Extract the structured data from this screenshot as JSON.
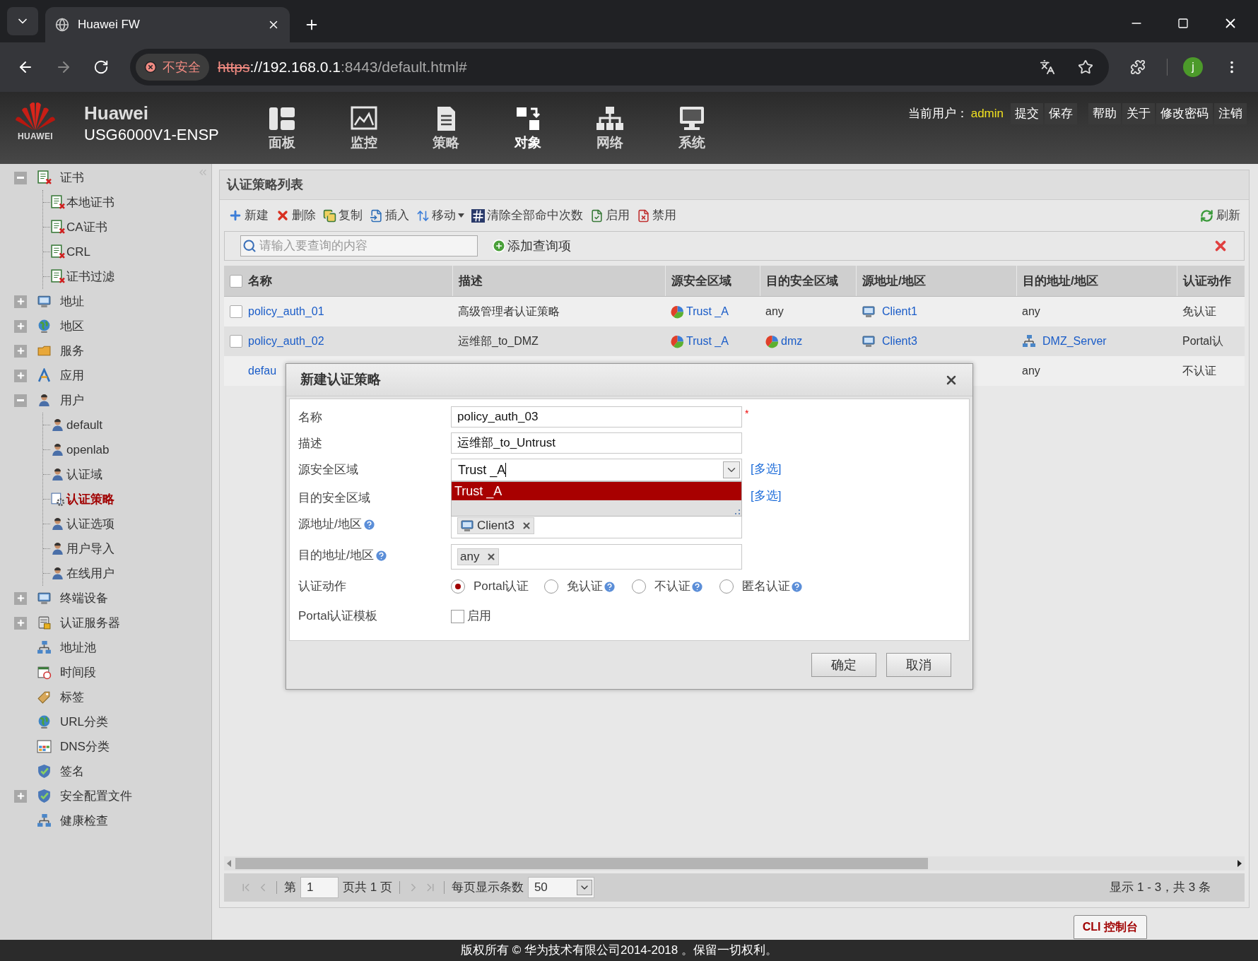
{
  "browser": {
    "tab_title": "Huawei FW",
    "security_label": "不安全",
    "url_scheme": "https",
    "url_host": "://192.168.0.1",
    "url_path": ":8443/default.html#",
    "profile_initial": "j"
  },
  "header": {
    "logo_text": "HUAWEI",
    "brand": "Huawei",
    "model": "USG6000V1-ENSP",
    "nav": [
      {
        "label": "面板",
        "selected": false
      },
      {
        "label": "监控",
        "selected": false
      },
      {
        "label": "策略",
        "selected": false
      },
      {
        "label": "对象",
        "selected": true
      },
      {
        "label": "网络",
        "selected": false
      },
      {
        "label": "系统",
        "selected": false
      }
    ],
    "user_label": "当前用户：",
    "user_name": "admin",
    "links": [
      "提交",
      "保存",
      "帮助",
      "关于",
      "修改密码",
      "注销"
    ]
  },
  "sidebar": {
    "items": [
      {
        "label": "证书",
        "expanded": true,
        "selected": false,
        "children": [
          {
            "label": "本地证书",
            "selected": false
          },
          {
            "label": "CA证书",
            "selected": false
          },
          {
            "label": "CRL",
            "selected": false
          },
          {
            "label": "证书过滤",
            "selected": false
          }
        ]
      },
      {
        "label": "地址",
        "expanded": false,
        "selected": false
      },
      {
        "label": "地区",
        "expanded": false,
        "selected": false
      },
      {
        "label": "服务",
        "expanded": false,
        "selected": false
      },
      {
        "label": "应用",
        "expanded": false,
        "selected": false
      },
      {
        "label": "用户",
        "expanded": true,
        "selected": false,
        "children": [
          {
            "label": "default",
            "selected": false
          },
          {
            "label": "openlab",
            "selected": false
          },
          {
            "label": "认证域",
            "selected": false
          },
          {
            "label": "认证策略",
            "selected": true
          },
          {
            "label": "认证选项",
            "selected": false
          },
          {
            "label": "用户导入",
            "selected": false
          },
          {
            "label": "在线用户",
            "selected": false
          }
        ]
      },
      {
        "label": "终端设备",
        "expanded": false,
        "selected": false
      },
      {
        "label": "认证服务器",
        "expanded": false,
        "selected": false
      },
      {
        "label": "地址池",
        "selected": false
      },
      {
        "label": "时间段",
        "selected": false
      },
      {
        "label": "标签",
        "selected": false
      },
      {
        "label": "URL分类",
        "selected": false
      },
      {
        "label": "DNS分类",
        "selected": false
      },
      {
        "label": "签名",
        "selected": false
      },
      {
        "label": "安全配置文件",
        "expanded": false,
        "selected": false
      },
      {
        "label": "健康检查",
        "selected": false
      }
    ]
  },
  "panel": {
    "title": "认证策略列表",
    "toolbar": [
      {
        "label": "新建",
        "has_menu": false
      },
      {
        "label": "删除",
        "has_menu": false
      },
      {
        "label": "复制",
        "has_menu": false
      },
      {
        "label": "插入",
        "has_menu": false
      },
      {
        "label": "移动",
        "has_menu": true
      },
      {
        "label": "清除全部命中次数",
        "has_menu": false
      },
      {
        "label": "启用",
        "has_menu": false
      },
      {
        "label": "禁用",
        "has_menu": false
      }
    ],
    "refresh": "刷新",
    "search": {
      "placeholder": "请输入要查询的内容"
    },
    "add_query": "添加查询项"
  },
  "table": {
    "all_checked": false,
    "columns": [
      "名称",
      "描述",
      "源安全区域",
      "目的安全区域",
      "源地址/地区",
      "目的地址/地区",
      "认证动作"
    ],
    "rows": [
      {
        "checked": false,
        "cells": {
          "name": {
            "text": "policy_auth_01",
            "kind": "link"
          },
          "description": {
            "text": "高级管理者认证策略",
            "kind": "plain"
          },
          "source_zone": {
            "text": "Trust _A",
            "kind": "zone"
          },
          "dest_zone": {
            "text": "any",
            "kind": "plain"
          },
          "source_address": {
            "text": "Client1",
            "kind": "host"
          },
          "dest_address": {
            "text": "any",
            "kind": "plain"
          },
          "action": {
            "text": "免认证",
            "kind": "plain"
          }
        }
      },
      {
        "checked": false,
        "cells": {
          "name": {
            "text": "policy_auth_02",
            "kind": "link"
          },
          "description": {
            "text": "运维部_to_DMZ",
            "kind": "plain"
          },
          "source_zone": {
            "text": "Trust _A",
            "kind": "zone"
          },
          "dest_zone": {
            "text": "dmz",
            "kind": "zone"
          },
          "source_address": {
            "text": "Client3",
            "kind": "host"
          },
          "dest_address": {
            "text": "DMZ_Server",
            "kind": "server"
          },
          "action": {
            "text": "Portal认",
            "kind": "plain"
          }
        }
      },
      {
        "cells": {
          "name": {
            "text": "defau",
            "kind": "link"
          },
          "dest_address": {
            "text": "any",
            "kind": "plain"
          },
          "action": {
            "text": "不认证",
            "kind": "plain"
          }
        }
      }
    ]
  },
  "pager": {
    "page_label": "第",
    "page": "1",
    "total_label": "页共 1 页",
    "page_size_label": "每页显示条数",
    "page_size": "50",
    "summary": "显示 1 - 3，共 3 条"
  },
  "dialog": {
    "title": "新建认证策略",
    "fields": [
      {
        "kind": "text",
        "label": "名称",
        "value": "policy_auth_03",
        "required_mark": "*"
      },
      {
        "kind": "text",
        "label": "描述",
        "value": "运维部_to_Untrust"
      },
      {
        "kind": "combo",
        "label": "源安全区域",
        "value": "Trust _A",
        "focused": true,
        "link": "[多选]",
        "options": [
          {
            "label": "Trust _A",
            "selected": true
          }
        ]
      },
      {
        "kind": "covered",
        "label": "目的安全区域",
        "link": "[多选]"
      },
      {
        "kind": "tags",
        "label": "源地址/地区",
        "help": true,
        "tags": [
          {
            "text": "Client3",
            "kind": "host"
          }
        ]
      },
      {
        "kind": "tags",
        "label": "目的地址/地区",
        "help": true,
        "tags": [
          {
            "text": "any",
            "kind": "plain"
          }
        ]
      },
      {
        "kind": "radio",
        "label": "认证动作",
        "options": [
          {
            "label": "Portal认证",
            "selected": true,
            "help": false
          },
          {
            "label": "免认证",
            "selected": false,
            "help": true
          },
          {
            "label": "不认证",
            "selected": false,
            "help": true
          },
          {
            "label": "匿名认证",
            "selected": false,
            "help": true
          }
        ]
      },
      {
        "kind": "checkbox",
        "label": "Portal认证模板",
        "text": "启用",
        "checked": false
      }
    ],
    "buttons": [
      "确定",
      "取消"
    ]
  },
  "cli_button": "CLI 控制台",
  "footer": "版权所有 © 华为技术有限公司2014-2018 。保留一切权利。"
}
